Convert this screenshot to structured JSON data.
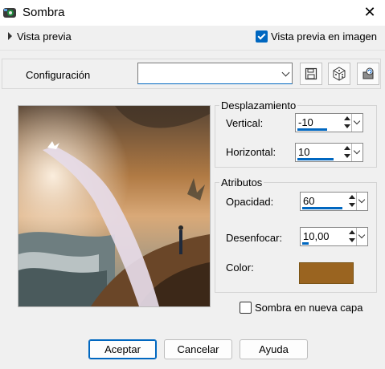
{
  "window": {
    "title": "Sombra",
    "close_glyph": "✕"
  },
  "preview": {
    "toggle_label": "Vista previa",
    "show_in_image_label": "Vista previa en imagen",
    "show_in_image_checked": true
  },
  "config": {
    "label": "Configuración",
    "value": "",
    "icons": [
      "save-icon",
      "random-dice-icon",
      "reset-icon"
    ]
  },
  "offset": {
    "title": "Desplazamiento",
    "vertical": {
      "label": "Vertical:",
      "value": "-10",
      "fill": 0.55
    },
    "horizontal": {
      "label": "Horizontal:",
      "value": "10",
      "fill": 0.6
    }
  },
  "attributes": {
    "title": "Atributos",
    "opacity": {
      "label": "Opacidad:",
      "value": "60",
      "fill": 0.6
    },
    "blur": {
      "label": "Desenfocar:",
      "value": "10,00",
      "fill": 0.1
    },
    "color": {
      "label": "Color:",
      "value": "#9a6420"
    }
  },
  "new_layer": {
    "label": "Sombra en nueva capa",
    "checked": false
  },
  "buttons": {
    "ok": "Aceptar",
    "cancel": "Cancelar",
    "help": "Ayuda"
  },
  "colors": {
    "accent": "#0067c0",
    "window_bg": "#f0f0f0"
  }
}
